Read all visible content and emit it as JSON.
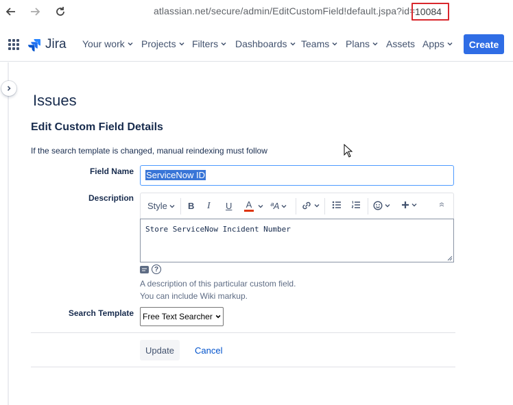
{
  "browser": {
    "url_visible": "atlassian.net/secure/admin/EditCustomField!default.jspa?id=",
    "url_id": "10084"
  },
  "header": {
    "logo": "Jira",
    "nav": [
      {
        "label": "Your work",
        "dropdown": true
      },
      {
        "label": "Projects",
        "dropdown": true
      },
      {
        "label": "Filters",
        "dropdown": true
      },
      {
        "label": "Dashboards",
        "dropdown": true
      },
      {
        "label": "Teams",
        "dropdown": true
      },
      {
        "label": "Plans",
        "dropdown": true
      },
      {
        "label": "Assets",
        "dropdown": false
      },
      {
        "label": "Apps",
        "dropdown": true
      }
    ],
    "create_label": "Create",
    "create_color": "#2f6de5"
  },
  "page": {
    "title": "Issues",
    "section_title": "Edit Custom Field Details",
    "hint": "If the search template is changed, manual reindexing must follow"
  },
  "form": {
    "field_name_label": "Field Name",
    "field_name_value": "ServiceNow ID",
    "description_label": "Description",
    "toolbar": {
      "style_label": "Style",
      "bold": "B",
      "italic": "I",
      "underline": "U",
      "text_color": "A",
      "font_size": "ªA"
    },
    "description_value": "Store ServiceNow Incident Number",
    "description_help_1": "A description of this particular custom field.",
    "description_help_2": "You can include Wiki markup.",
    "help_icon_glyph": "?",
    "search_template_label": "Search Template",
    "search_template_value": "Free Text Searcher",
    "update_label": "Update",
    "cancel_label": "Cancel"
  }
}
